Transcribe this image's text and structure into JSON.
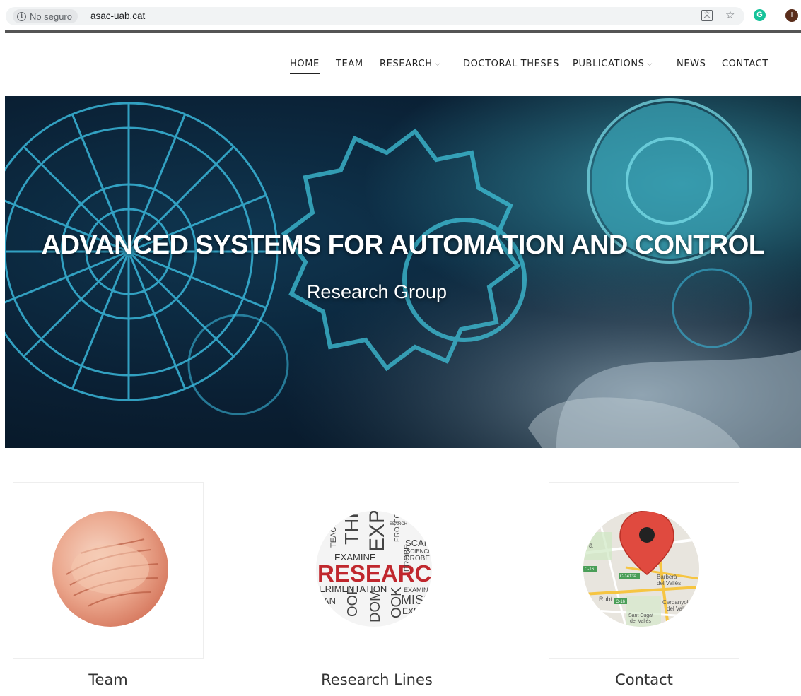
{
  "browser": {
    "security_label": "No seguro",
    "url": "asac-uab.cat",
    "profile_initial": "I",
    "grammarly_letter": "G",
    "translate_glyph": "文",
    "star_glyph": "☆",
    "info_glyph": "i"
  },
  "nav": {
    "items": [
      {
        "label": "HOME",
        "active": true
      },
      {
        "label": "TEAM"
      },
      {
        "label": "RESEARCH",
        "dropdown": true
      },
      {
        "label": "DOCTORAL THESES"
      },
      {
        "label": "PUBLICATIONS",
        "dropdown": true
      },
      {
        "label": "NEWS"
      },
      {
        "label": "CONTACT"
      }
    ],
    "chevron_glyph": "⌵"
  },
  "hero": {
    "title": "ADVANCED SYSTEMS FOR AUTOMATION AND CONTROL",
    "subtitle": "Research Group"
  },
  "cards": [
    {
      "label": "Team",
      "image": "hands-together"
    },
    {
      "label": "Research Lines",
      "image": "research-word-cloud"
    },
    {
      "label": "Contact",
      "image": "map-location-pin"
    }
  ],
  "research_words": {
    "big": "RESEARCH",
    "row_exp": "EXP",
    "row_thi": "THI",
    "row_examine": "EXAMINE",
    "row_probe": "PROBE",
    "row_scan": "SCAN",
    "row_science": "SCIENCE",
    "row_teach": "TEACH",
    "row_experiment": "ERIMENTATION",
    "row_examin": "EXAMIN",
    "row_miss": "MISS",
    "row_an": "AN",
    "row_dom": "DOM",
    "row_ook": "OOK",
    "row_oof": "OOF",
    "row_expe": "EXPE",
    "row_project": "PROJECT",
    "row_search": "SEARCH"
  },
  "map_labels": {
    "a": "a",
    "barbera": "Barberà",
    "del_valles_1": "del Vallès",
    "rubi": "Rubí",
    "cerdanyola": "Cerdanyol",
    "del_valles_2": "del Vall",
    "sant_cugat": "Sant Cugat",
    "del_valles_3": "del Vallès",
    "c16": "C-16",
    "c1413a": "C-1413a",
    "c16b": "C-16"
  },
  "colors": {
    "hero_bg": "#0a1f33",
    "gear_line": "#39b6d9",
    "research_red": "#c0272d",
    "pin_red": "#e04a3f",
    "map_road": "#f6c542"
  }
}
